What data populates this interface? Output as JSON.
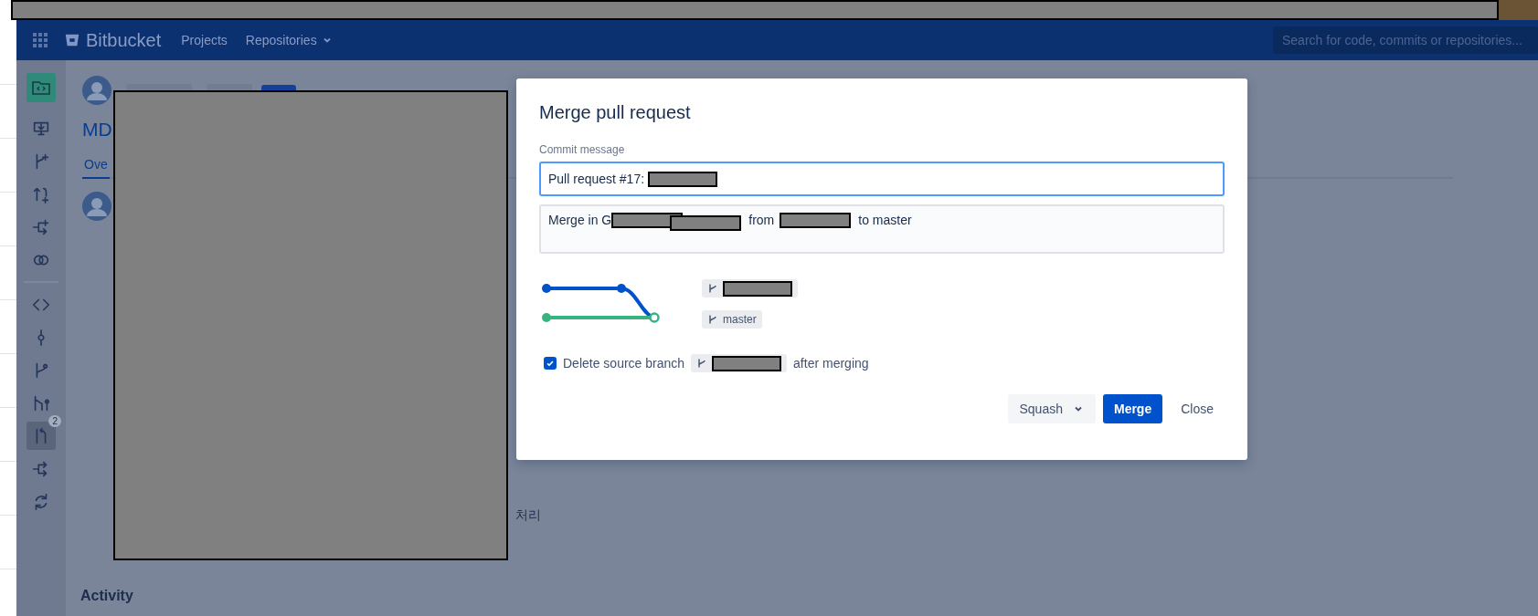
{
  "header": {
    "app_name": "Bitbucket",
    "nav": [
      {
        "label": "Projects",
        "dropdown": false
      },
      {
        "label": "Repositories",
        "dropdown": true
      }
    ],
    "search": {
      "placeholder": "Search for code, commits or repositories..."
    }
  },
  "sidebar": {
    "repository": {
      "selected": false
    },
    "actions": [
      {
        "kind": "clone",
        "selected": false
      },
      {
        "kind": "create-branch",
        "selected": false
      },
      {
        "kind": "create-pull-request",
        "selected": false
      },
      {
        "kind": "create-fork",
        "selected": false
      },
      {
        "kind": "compare",
        "selected": false
      }
    ],
    "navigation": [
      {
        "kind": "source",
        "selected": false
      },
      {
        "kind": "commits",
        "selected": false
      },
      {
        "kind": "branches",
        "selected": false
      },
      {
        "kind": "graph",
        "selected": false
      },
      {
        "kind": "pull-requests",
        "selected": true,
        "badge": "2"
      },
      {
        "kind": "forks",
        "selected": false
      },
      {
        "kind": "sync",
        "selected": false
      }
    ]
  },
  "pull_request": {
    "title": "MD",
    "tab": "Ove",
    "fragment": "처리",
    "activity": "Activity"
  },
  "dialog": {
    "title": "Merge pull request",
    "commit_label": "Commit message",
    "commit_value": "Pull request #17: ",
    "description": [
      "Merge in G",
      "from",
      "to master"
    ],
    "graph": {
      "target_branch": "master"
    },
    "delete_source": {
      "checked": true,
      "label": "Delete source branch",
      "suffix": "after merging"
    },
    "strategy": "Squash",
    "merge_button": "Merge",
    "close_button": "Close"
  }
}
